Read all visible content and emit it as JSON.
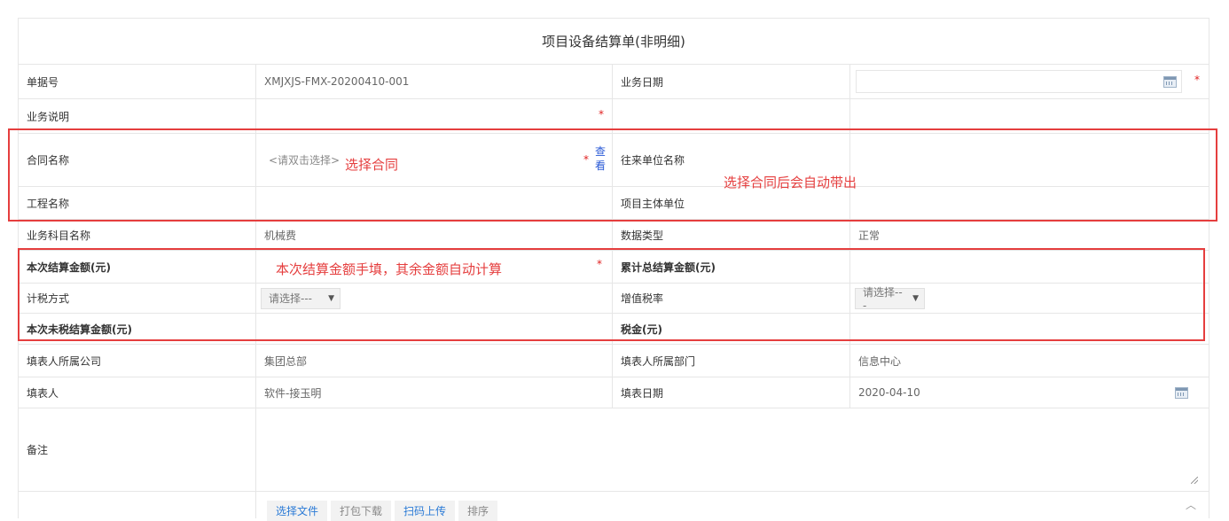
{
  "form": {
    "title": "项目设备结算单(非明细)",
    "rows": {
      "bill_no": {
        "label": "单据号",
        "value": "XMJXJS-FMX-20200410-001"
      },
      "biz_date": {
        "label": "业务日期",
        "value": ""
      },
      "biz_desc": {
        "label": "业务说明"
      },
      "contract_name": {
        "label": "合同名称",
        "placeholder": "<请双击选择>",
        "view_link": "查看"
      },
      "partner_name": {
        "label": "往来单位名称"
      },
      "project_name": {
        "label": "工程名称"
      },
      "project_entity": {
        "label": "项目主体单位"
      },
      "subject_name": {
        "label": "业务科目名称",
        "value": "机械费"
      },
      "data_type": {
        "label": "数据类型",
        "value": "正常"
      },
      "settle_amount": {
        "label": "本次结算金额(元)"
      },
      "total_settle": {
        "label": "累计总结算金额(元)"
      },
      "tax_method": {
        "label": "计税方式",
        "select_value": "请选择---"
      },
      "vat_rate": {
        "label": "增值税率",
        "select_value": "请选择---"
      },
      "untaxed_amount": {
        "label": "本次未税结算金额(元)"
      },
      "tax": {
        "label": "税金(元)"
      },
      "company": {
        "label": "填表人所属公司",
        "value": "集团总部"
      },
      "department": {
        "label": "填表人所属部门",
        "value": "信息中心"
      },
      "filler": {
        "label": "填表人",
        "value": "软件-接玉明"
      },
      "fill_date": {
        "label": "填表日期",
        "value": "2020-04-10"
      },
      "remark": {
        "label": "备注"
      }
    },
    "required_mark": "*",
    "bottom_buttons": [
      "选择文件",
      "打包下载",
      "扫码上传",
      "排序"
    ]
  },
  "annotations": {
    "select_contract": "选择合同",
    "auto_fill": "选择合同后会自动带出",
    "amount_note": "本次结算金额手填，其余金额自动计算",
    "color": "#e53e3e"
  },
  "icons": {
    "calendar": "calendar-icon",
    "dropdown": "caret-down-icon",
    "resize": "resize-grip-icon",
    "collapse": "chevron-up-icon"
  }
}
